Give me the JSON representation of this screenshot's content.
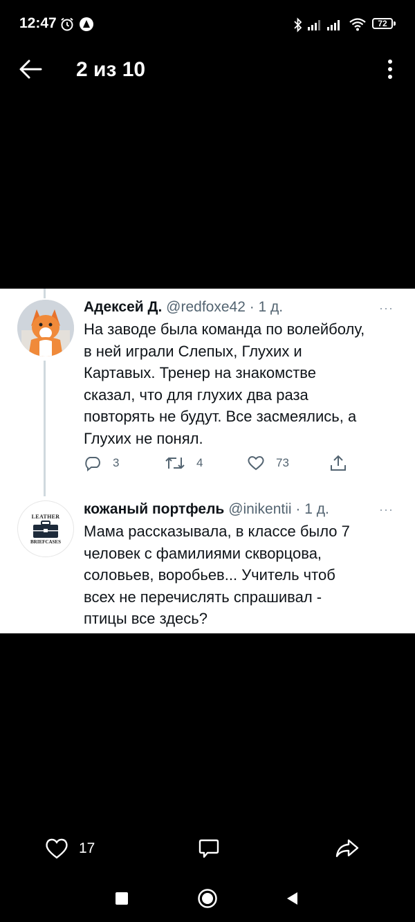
{
  "status_bar": {
    "time": "12:47",
    "battery": "72",
    "icons": [
      "alarm-icon",
      "app-notification-icon",
      "bluetooth-icon",
      "signal-icon",
      "signal-icon",
      "wifi-icon",
      "battery-icon"
    ]
  },
  "viewer": {
    "counter": "2 из 10"
  },
  "tweets": [
    {
      "name": "Адексей Д.",
      "meta": "@redfoxe42 · 1 д.",
      "lines": [
        "На заводе была команда по волейболу,",
        "в ней играли Слепых, Глухих и",
        "Картавых. Тренер на знакомстве",
        "сказал, что для глухих два раза",
        "повторять не будут. Все засмеялись, а",
        "Глухих не понял."
      ],
      "replies": "3",
      "retweets": "4",
      "likes": "73",
      "more": "···"
    },
    {
      "name": "кожаный портфель",
      "meta": "@inikentii · 1 д.",
      "avatar_top": "LEATHER",
      "avatar_bottom": "BRIEFCASES",
      "lines": [
        "Мама рассказывала, в классе было 7",
        "человек с фамилиями скворцова,",
        "соловьев, воробьев...  Учитель чтоб",
        "всех не перечислять спрашивал -",
        "птицы все здесь?"
      ],
      "more": "···"
    }
  ],
  "bottom_bar": {
    "likes": "17"
  }
}
